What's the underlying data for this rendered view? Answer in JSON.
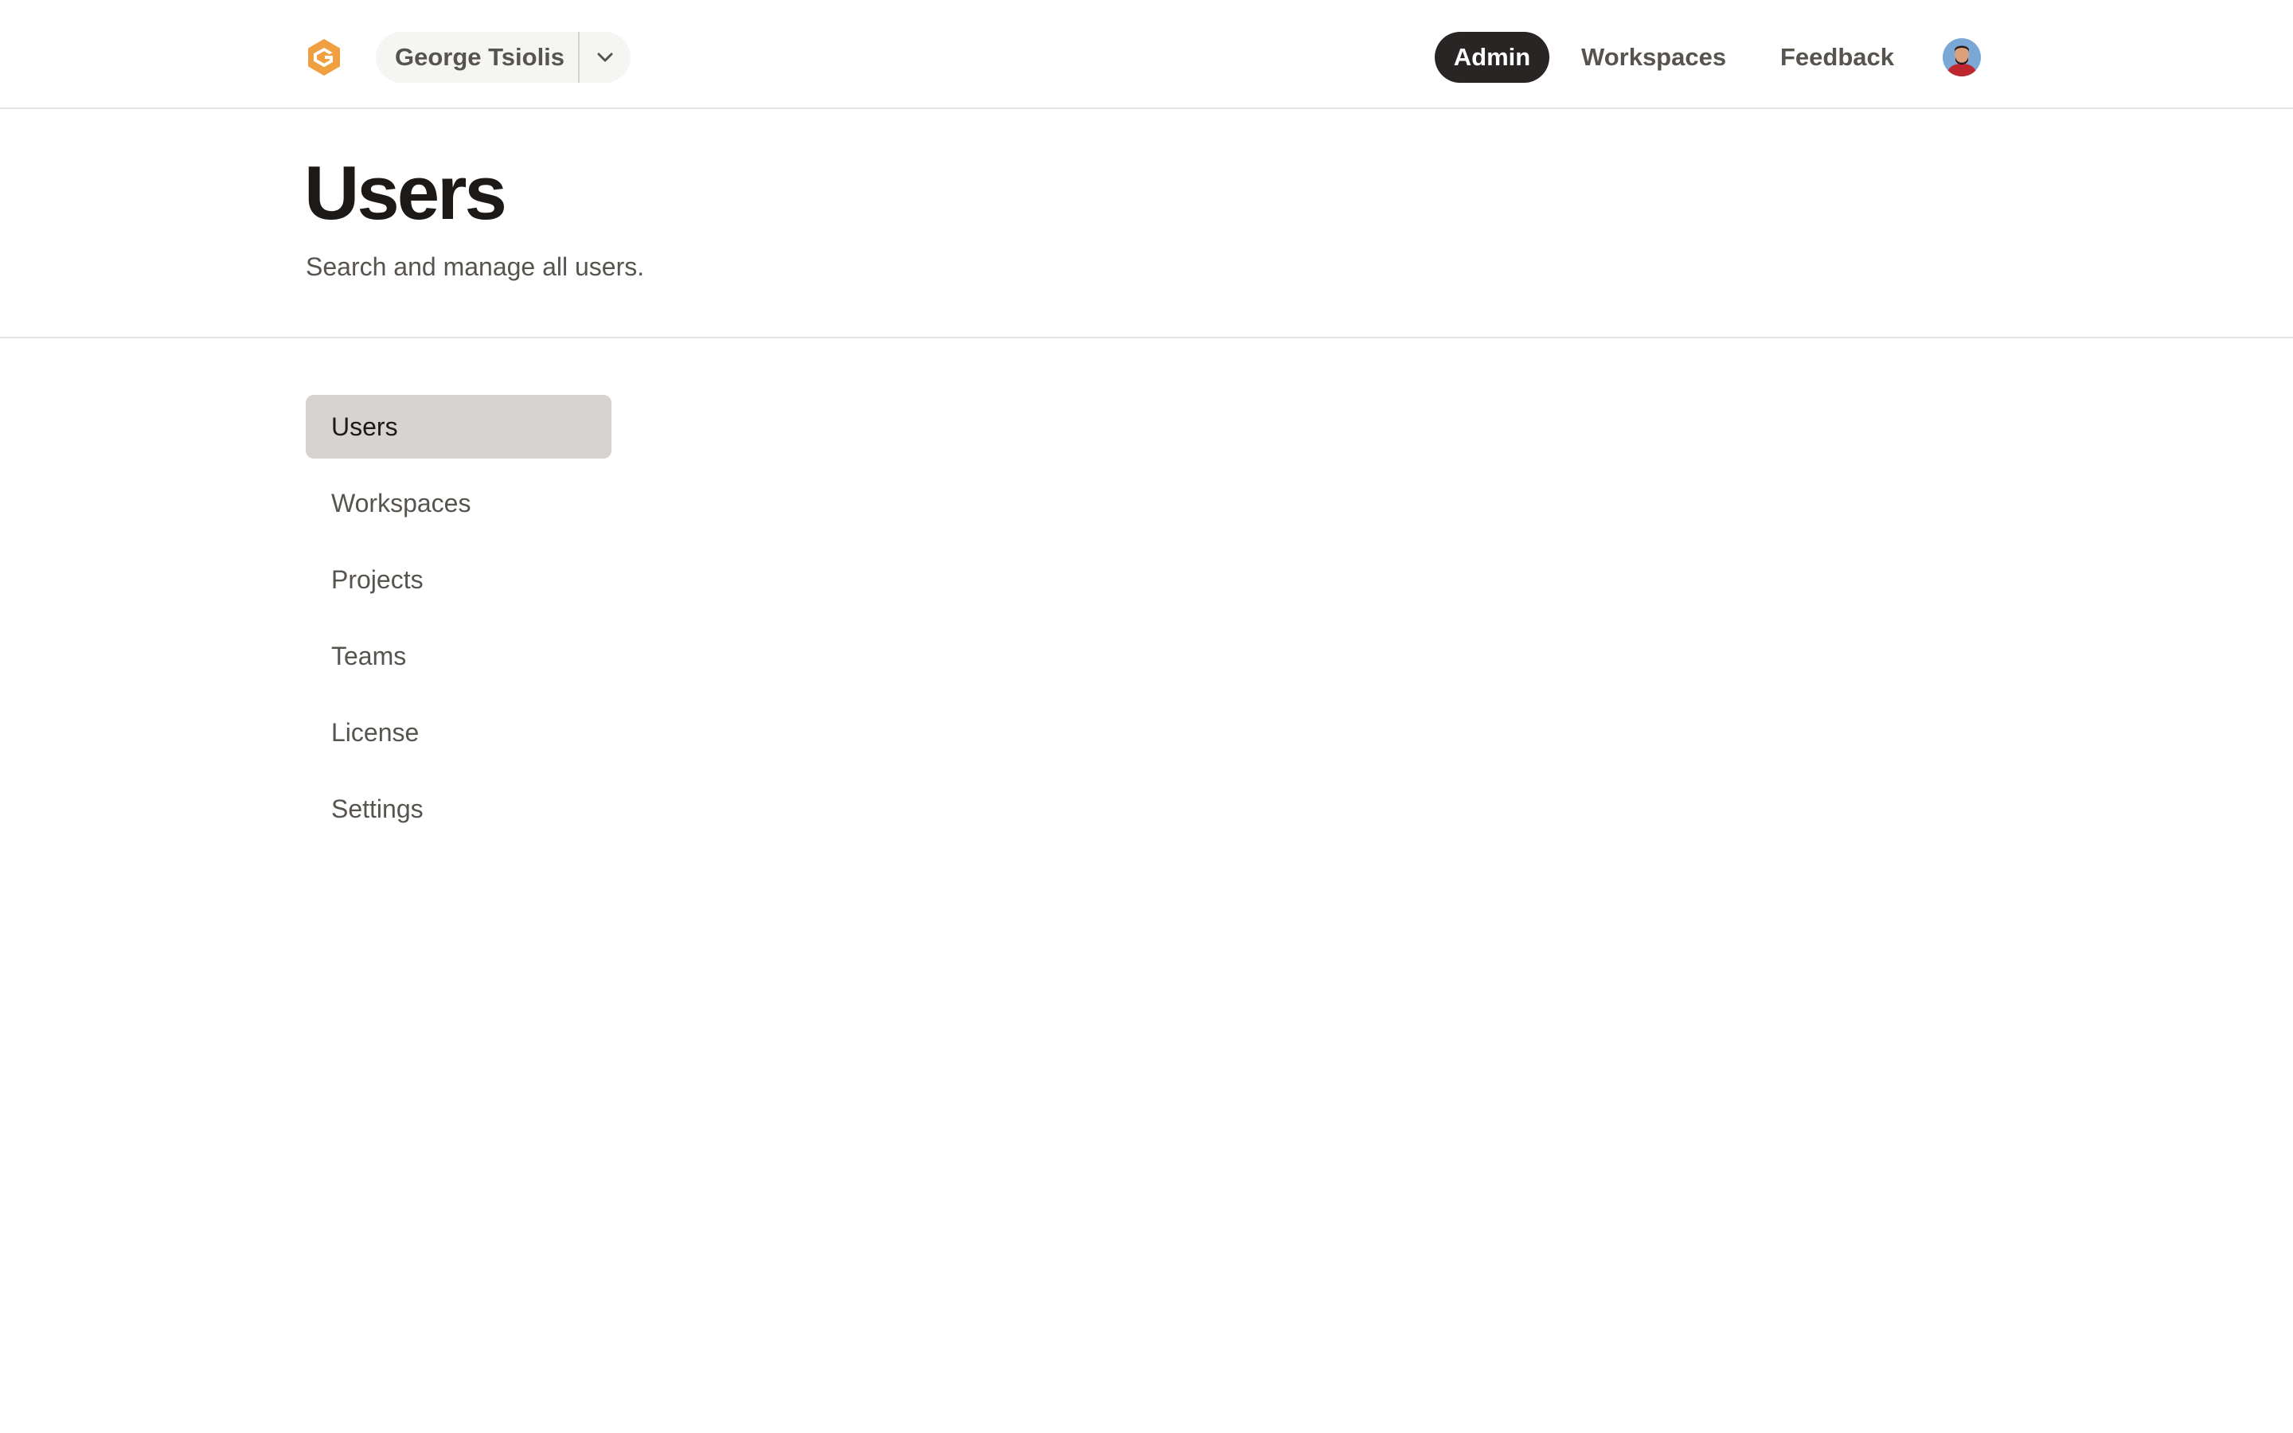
{
  "header": {
    "logo_icon": "brand-hexagon-logo-icon",
    "brand_color": "#f0a040",
    "account": {
      "name": "George Tsiolis",
      "menu_icon": "chevron-down-icon"
    },
    "nav": {
      "admin": "Admin",
      "workspaces": "Workspaces",
      "feedback": "Feedback"
    },
    "avatar_icon": "user-avatar-icon"
  },
  "page": {
    "title": "Users",
    "subtitle": "Search and manage all users."
  },
  "sidebar": {
    "active_index": 0,
    "items": [
      {
        "label": "Users"
      },
      {
        "label": "Workspaces"
      },
      {
        "label": "Projects"
      },
      {
        "label": "Teams"
      },
      {
        "label": "License"
      },
      {
        "label": "Settings"
      }
    ]
  }
}
